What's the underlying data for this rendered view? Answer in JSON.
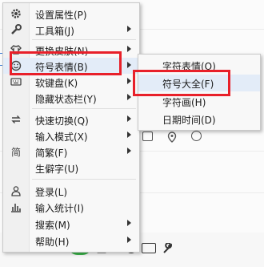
{
  "menu": {
    "items": [
      {
        "label": "设置属性(P)",
        "icon": "gear-icon",
        "submenu": false
      },
      {
        "label": "工具箱(J)",
        "icon": "wrench-icon",
        "submenu": true
      },
      {
        "label": "更换皮肤(N)",
        "icon": "shirt-icon",
        "submenu": true
      },
      {
        "label": "符号表情(B)",
        "icon": "smiley-icon",
        "submenu": true,
        "highlighted": true
      },
      {
        "label": "软键盘(K)",
        "icon": "keyboard-icon",
        "submenu": true
      },
      {
        "label": "隐藏状态栏(Y)",
        "icon": "",
        "submenu": true
      },
      {
        "label": "快速切换(Q)",
        "icon": "switch-arrows-icon",
        "submenu": true
      },
      {
        "label": "输入模式(X)",
        "icon": "",
        "submenu": true
      },
      {
        "label": "简繁(F)",
        "icon": "jian-char-icon",
        "submenu": true
      },
      {
        "label": "生僻字(U)",
        "icon": "",
        "submenu": false
      },
      {
        "label": "登录(L)",
        "icon": "user-icon",
        "submenu": false
      },
      {
        "label": "输入统计(I)",
        "icon": "bar-chart-icon",
        "submenu": false
      },
      {
        "label": "搜索(M)",
        "icon": "",
        "submenu": true
      },
      {
        "label": "帮助(H)",
        "icon": "",
        "submenu": true
      }
    ],
    "jian_glyph": "简"
  },
  "submenu": {
    "items": [
      {
        "label": "字符表情(O)"
      },
      {
        "label": "符号大全(F)",
        "highlighted": true
      },
      {
        "label": "字符画(H)"
      },
      {
        "label": "日期时间(D)"
      }
    ]
  },
  "colors": {
    "highlight_box": "#e8202a",
    "hover_bg": "#e3ecf8",
    "tray_green": "#3bb54a"
  }
}
